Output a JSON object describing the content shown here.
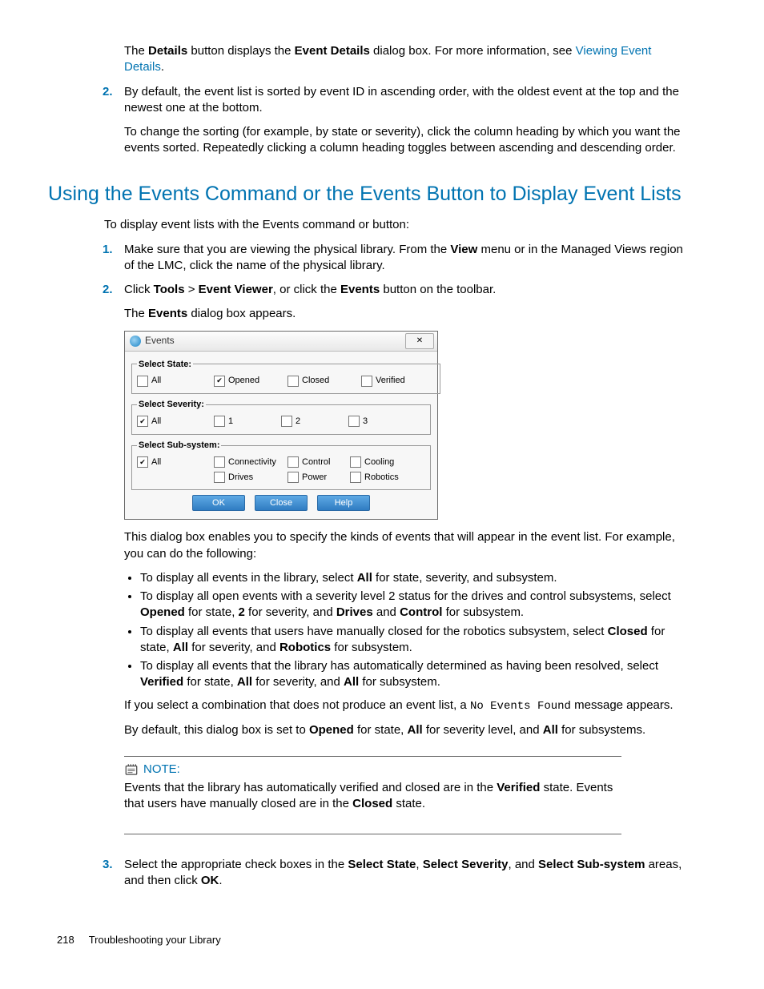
{
  "top": {
    "p1a": "The ",
    "p1_details": "Details",
    "p1b": " button displays the ",
    "p1_eventdetails": "Event Details",
    "p1c": " dialog box. For more information, see ",
    "p1_link": "Viewing Event Details",
    "p1d": "."
  },
  "step2": {
    "num": "2.",
    "p1": "By default, the event list is sorted by event ID in ascending order, with the oldest event at the top and the newest one at the bottom.",
    "p2": "To change the sorting (for example, by state or severity), click the column heading by which you want the events sorted. Repeatedly clicking a column heading toggles between ascending and descending order."
  },
  "heading": "Using the Events Command or the Events Button to Display Event Lists",
  "intro": "To display event lists with the Events command or button:",
  "s1": {
    "num": "1.",
    "a": "Make sure that you are viewing the physical library. From the ",
    "view": "View",
    "b": " menu or in the Managed Views region of the LMC, click the name of the physical library."
  },
  "s2": {
    "num": "2.",
    "a": "Click ",
    "tools": "Tools",
    "gt": " > ",
    "ev": "Event Viewer",
    "b": ", or click the ",
    "events": "Events",
    "c": " button on the toolbar.",
    "line2a": "The ",
    "line2b": "Events",
    "line2c": " dialog box appears."
  },
  "dialog": {
    "title": "Events",
    "ghost": "",
    "close": "✕",
    "state": {
      "legend": "Select State:",
      "all": "All",
      "opened": "Opened",
      "closed": "Closed",
      "verified": "Verified"
    },
    "severity": {
      "legend": "Select Severity:",
      "all": "All",
      "v1": "1",
      "v2": "2",
      "v3": "3"
    },
    "sub": {
      "legend": "Select Sub-system:",
      "all": "All",
      "connectivity": "Connectivity",
      "control": "Control",
      "cooling": "Cooling",
      "drives": "Drives",
      "power": "Power",
      "robotics": "Robotics"
    },
    "ok": "OK",
    "closeBtn": "Close",
    "help": "Help"
  },
  "afterDialog": {
    "p": "This dialog box enables you to specify the kinds of events that will appear in the event list. For example, you can do the following:"
  },
  "bul1": {
    "a": "To display all events in the library, select ",
    "all": "All",
    "b": " for state, severity, and subsystem."
  },
  "bul2": {
    "a": "To display all open events with a severity level 2 status for the drives and control subsystems, select ",
    "opened": "Opened",
    "b": " for state, ",
    "two": "2",
    "c": " for severity, and ",
    "drives": "Drives",
    "d": " and ",
    "control": "Control",
    "e": " for subsystem."
  },
  "bul3": {
    "a": "To display all events that users have manually closed for the robotics subsystem, select ",
    "closed": "Closed",
    "b": " for state, ",
    "all": "All",
    "c": " for severity, and ",
    "robotics": "Robotics",
    "d": " for subsystem."
  },
  "bul4": {
    "a": "To display all events that the library has automatically determined as having been resolved, select ",
    "verified": "Verified",
    "b": " for state, ",
    "all1": "All",
    "c": " for severity, and ",
    "all2": "All",
    "d": " for subsystem."
  },
  "noevents": {
    "a": "If you select a combination that does not produce an event list, a ",
    "code": "No Events Found",
    "b": " message appears."
  },
  "defaults": {
    "a": "By default, this dialog box is set to ",
    "opened": "Opened",
    "b": " for state, ",
    "all1": "All",
    "c": " for severity level, and ",
    "all2": "All",
    "d": " for subsystems."
  },
  "note": {
    "label": "NOTE:",
    "a": "Events that the library has automatically verified and closed are in the ",
    "verified": "Verified",
    "b": " state. Events that users have manually closed are in the ",
    "closed": "Closed",
    "c": " state."
  },
  "s3": {
    "num": "3.",
    "a": "Select the appropriate check boxes in the ",
    "ss": "Select State",
    "b": ", ",
    "sv": "Select Severity",
    "c": ", and ",
    "sb": "Select Sub-system",
    "d": " areas, and then click ",
    "ok": "OK",
    "e": "."
  },
  "footer": {
    "page": "218",
    "title": "Troubleshooting your Library"
  }
}
